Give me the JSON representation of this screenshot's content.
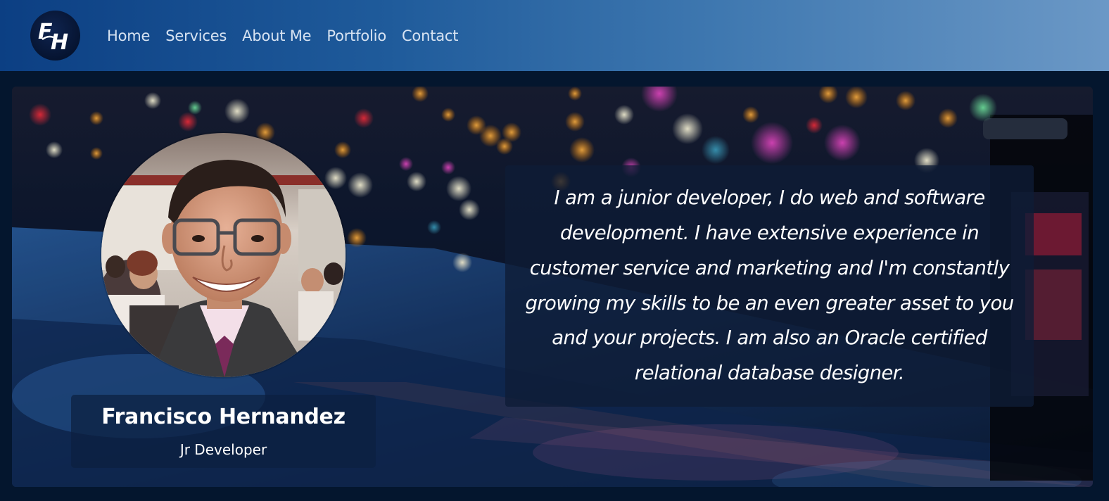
{
  "navbar": {
    "logo_icon": "fh-monogram-logo",
    "links": [
      {
        "label": "Home"
      },
      {
        "label": "Services"
      },
      {
        "label": "About Me"
      },
      {
        "label": "Portfolio"
      },
      {
        "label": "Contact"
      }
    ]
  },
  "profile": {
    "photo": "portrait-photo",
    "name": "Francisco Hernandez",
    "role": "Jr Developer"
  },
  "bio": {
    "text": "I am a junior developer, I do web and software development. I have extensive experience in customer service and marketing and I'm constantly growing my skills to be an even greater asset to you and your projects. I am also an Oracle certified relational database designer."
  },
  "colors": {
    "navbar_start": "#0c3f83",
    "navbar_end": "#6b98c6",
    "page_background": "#04162e",
    "text_primary": "#ffffff",
    "nav_text": "#d7e3f2"
  }
}
